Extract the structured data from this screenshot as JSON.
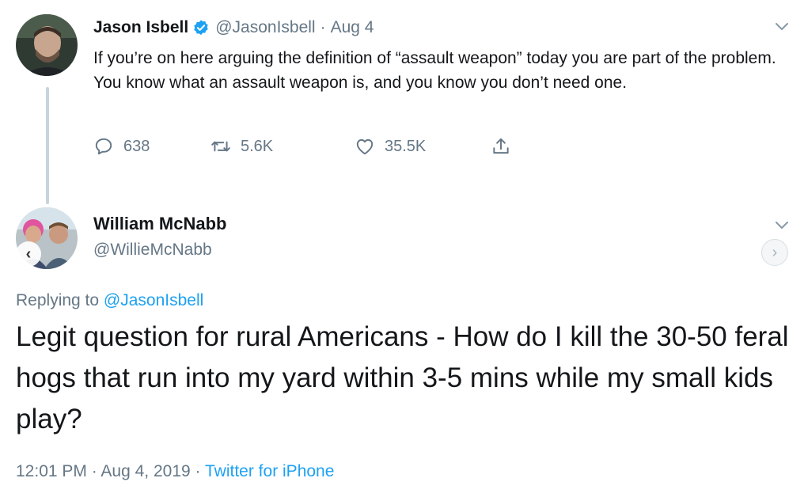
{
  "tweet": {
    "author_name": "Jason Isbell",
    "author_handle": "@JasonIsbell",
    "separator": "·",
    "date": "Aug 4",
    "text": "If you’re on here arguing the definition of “assault weapon” today you are part of the problem. You know what an assault weapon is, and you know you don’t need one.",
    "reply_count": "638",
    "retweet_count": "5.6K",
    "like_count": "35.5K",
    "icons": {
      "verified": "verified-badge-icon",
      "more": "chevron-down-icon",
      "reply": "reply-icon",
      "retweet": "retweet-icon",
      "like": "heart-icon",
      "share": "share-icon"
    }
  },
  "reply": {
    "author_name": "William McNabb",
    "author_handle": "@WillieMcNabb",
    "replying_label": "Replying to",
    "replying_to": "@JasonIsbell",
    "text": "Legit question for rural Americans - How do I kill the 30-50 feral hogs that run into my yard within 3-5 mins while my small kids play?",
    "time": "12:01 PM",
    "separator": "·",
    "date": "Aug 4, 2019",
    "source": "Twitter for iPhone",
    "nav": {
      "prev": "‹",
      "next": "›"
    },
    "icons": {
      "more": "chevron-down-icon",
      "prev": "chevron-left-icon",
      "next": "chevron-right-icon"
    }
  },
  "colors": {
    "text": "#14171a",
    "secondary": "#657786",
    "link": "#1da1f2",
    "verified": "#1da1f2",
    "thread_line": "#c8d4dd"
  }
}
